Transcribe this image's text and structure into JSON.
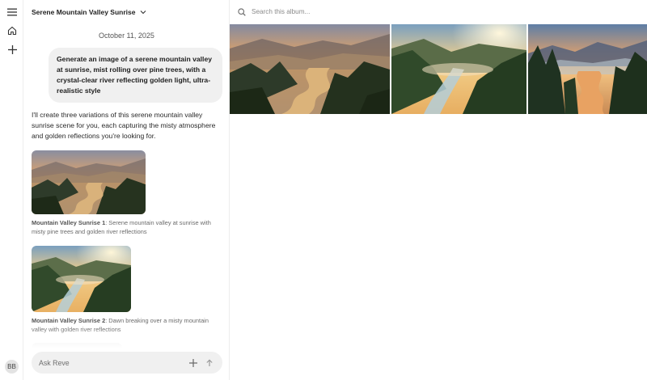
{
  "album": {
    "title": "Serene Mountain Valley Sunrise",
    "search_placeholder": "Search this album..."
  },
  "chat": {
    "date": "October 11, 2025",
    "user_prompt": "Generate an image of a serene mountain valley at sunrise, mist rolling over pine trees, with a crystal-clear river reflecting golden light, ultra-realistic style",
    "assistant_reply": "I'll create three variations of this serene mountain valley sunrise scene for you, each capturing the misty atmosphere and golden reflections you're looking for.",
    "results": [
      {
        "title": "Mountain Valley Sunrise 1",
        "desc": ": Serene mountain valley at sunrise with misty pine trees and golden river reflections"
      },
      {
        "title": "Mountain Valley Sunrise 2",
        "desc": ": Dawn breaking over a misty mountain valley with golden river reflections"
      }
    ],
    "input_placeholder": "Ask Reve"
  },
  "user": {
    "initials": "BB"
  },
  "icons": {
    "menu": "menu-icon",
    "home": "home-icon",
    "new": "plus-icon",
    "chevron": "chevron-down-icon",
    "search": "search-icon",
    "attach": "plus-icon",
    "send": "arrow-up-icon"
  }
}
